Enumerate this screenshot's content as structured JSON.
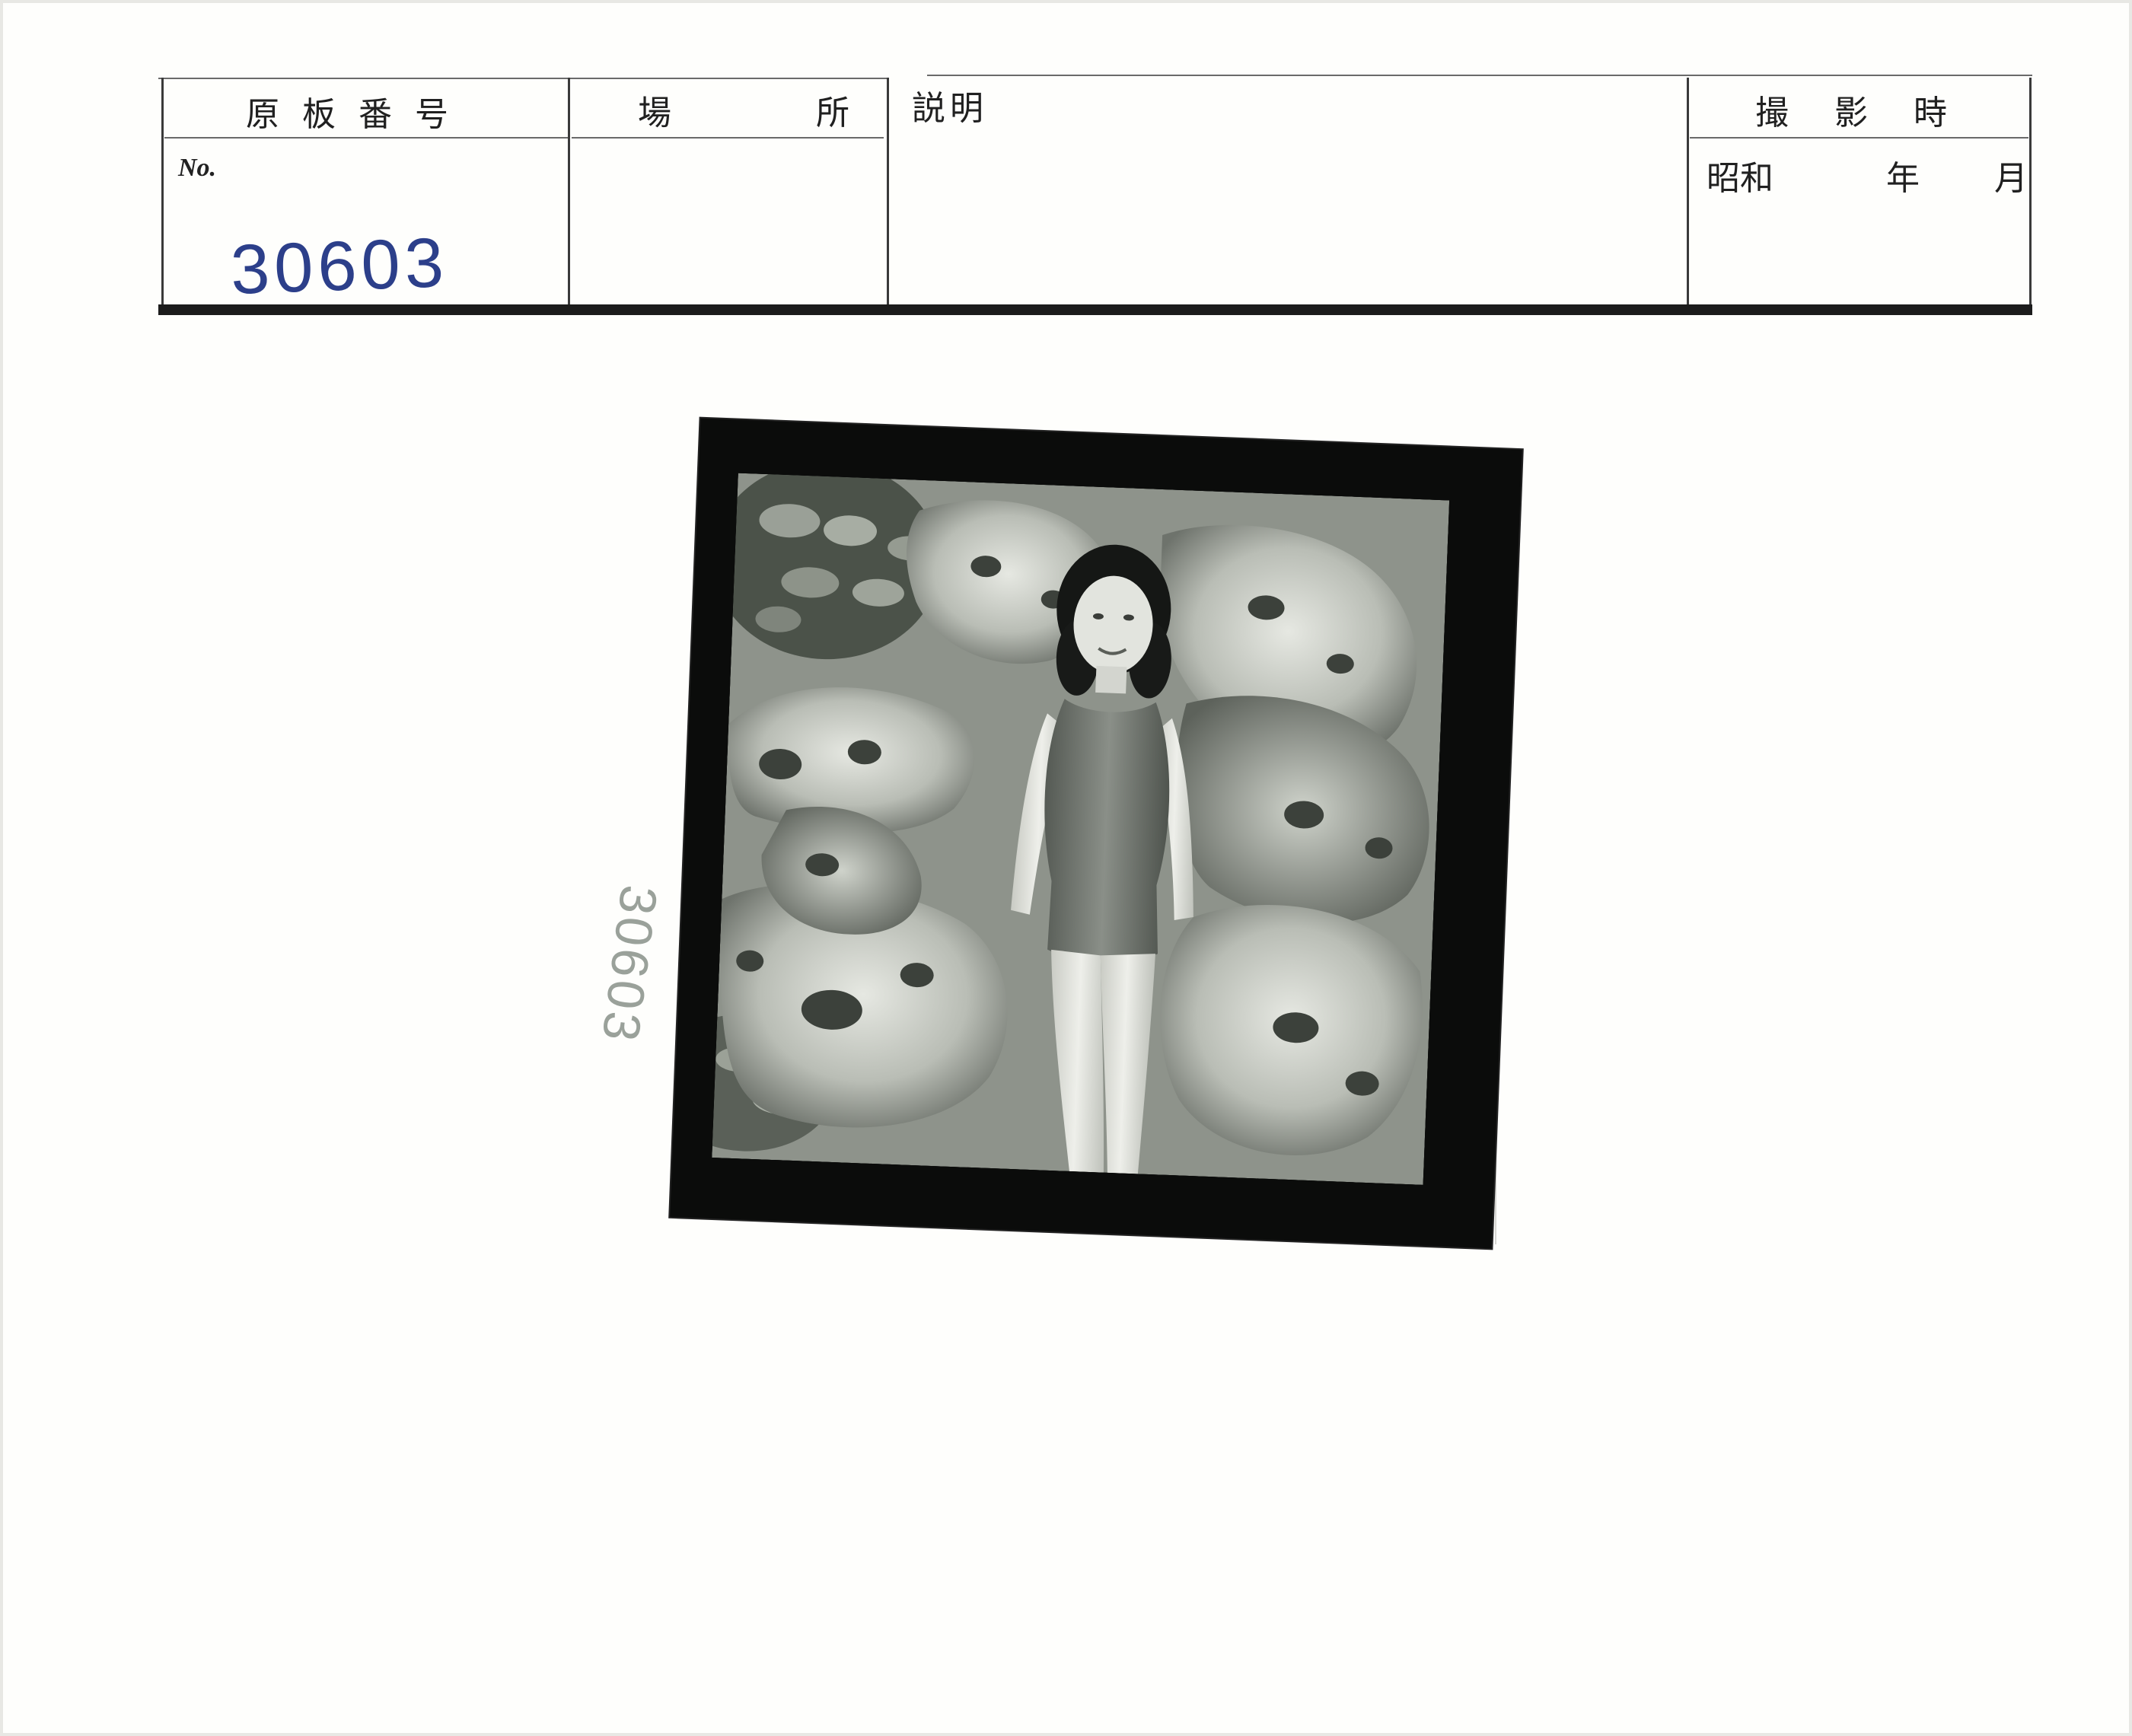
{
  "form": {
    "plate_number_header": "原板番号",
    "location_header": "場　　所",
    "description_header": "説明",
    "shooting_time_header": "撮影時",
    "no_label": "No.",
    "era_label": "昭和",
    "year_label": "年",
    "month_label": "月",
    "plate_number_value": "30603"
  },
  "photo": {
    "edge_code": "30603"
  }
}
